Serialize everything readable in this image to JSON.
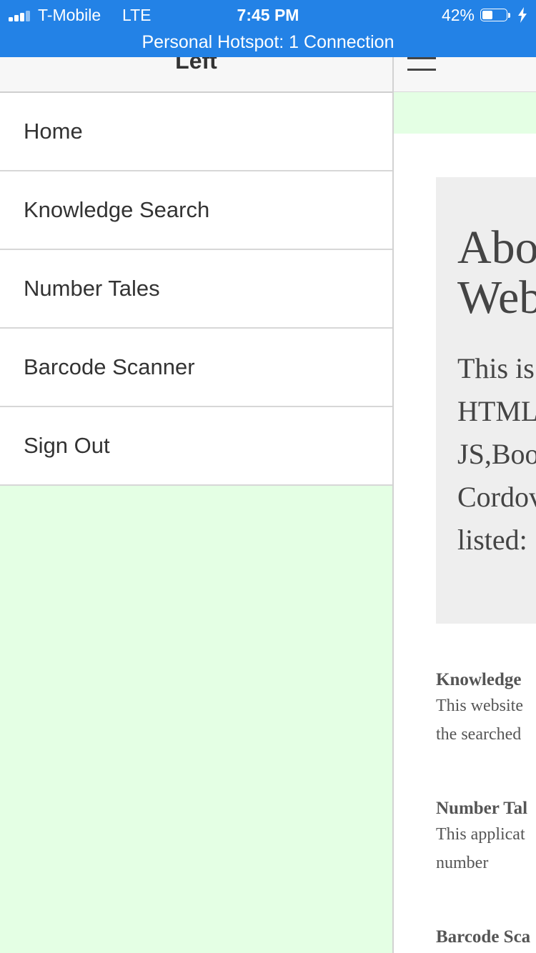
{
  "status_bar": {
    "carrier": "T-Mobile",
    "network": "LTE",
    "time": "7:45 PM",
    "battery_percent": "42%",
    "battery_level": 0.42,
    "hotspot": "Personal Hotspot: 1 Connection"
  },
  "left_panel": {
    "title": "Left",
    "menu": [
      {
        "label": "Home"
      },
      {
        "label": "Knowledge Search"
      },
      {
        "label": "Number Tales"
      },
      {
        "label": "Barcode Scanner"
      },
      {
        "label": "Sign Out"
      }
    ]
  },
  "right_panel": {
    "jumbotron": {
      "title_line1": "Abo",
      "title_line2": "Web",
      "text_lines": [
        "This is",
        "HTML",
        "JS,Boo",
        "Cordov",
        "listed:"
      ]
    },
    "features": [
      {
        "title": "Knowledge",
        "desc_lines": [
          "This website",
          "the searched"
        ]
      },
      {
        "title": "Number Tal",
        "desc_lines": [
          "This applicat",
          "number"
        ]
      },
      {
        "title": "Barcode Sca",
        "desc_lines": []
      }
    ]
  },
  "colors": {
    "status_bar": "#2382e6",
    "menu_background": "#e4ffe4",
    "jumbotron": "#eeeeee"
  }
}
